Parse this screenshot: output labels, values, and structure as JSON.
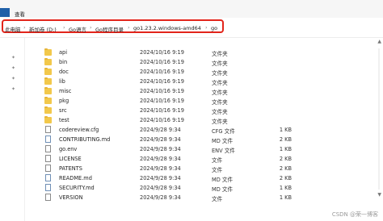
{
  "menubar": {
    "view_label": "查看"
  },
  "breadcrumb": {
    "items": [
      "此电脑",
      "新加卷 (D:)",
      "Go语言",
      "Go程序目录",
      "go1.23.2.windows-amd64",
      "go"
    ],
    "separator": "›"
  },
  "files": [
    {
      "name": "api",
      "date": "2024/10/16 9:19",
      "type": "文件夹",
      "size": "",
      "kind": "folder"
    },
    {
      "name": "bin",
      "date": "2024/10/16 9:19",
      "type": "文件夹",
      "size": "",
      "kind": "folder"
    },
    {
      "name": "doc",
      "date": "2024/10/16 9:19",
      "type": "文件夹",
      "size": "",
      "kind": "folder"
    },
    {
      "name": "lib",
      "date": "2024/10/16 9:19",
      "type": "文件夹",
      "size": "",
      "kind": "folder"
    },
    {
      "name": "misc",
      "date": "2024/10/16 9:19",
      "type": "文件夹",
      "size": "",
      "kind": "folder"
    },
    {
      "name": "pkg",
      "date": "2024/10/16 9:19",
      "type": "文件夹",
      "size": "",
      "kind": "folder"
    },
    {
      "name": "src",
      "date": "2024/10/16 9:19",
      "type": "文件夹",
      "size": "",
      "kind": "folder"
    },
    {
      "name": "test",
      "date": "2024/10/16 9:19",
      "type": "文件夹",
      "size": "",
      "kind": "folder"
    },
    {
      "name": "codereview.cfg",
      "date": "2024/9/28 9:34",
      "type": "CFG 文件",
      "size": "1 KB",
      "kind": "file"
    },
    {
      "name": "CONTRIBUTING.md",
      "date": "2024/9/28 9:34",
      "type": "MD 文件",
      "size": "2 KB",
      "kind": "md"
    },
    {
      "name": "go.env",
      "date": "2024/9/28 9:34",
      "type": "ENV 文件",
      "size": "1 KB",
      "kind": "file"
    },
    {
      "name": "LICENSE",
      "date": "2024/9/28 9:34",
      "type": "文件",
      "size": "2 KB",
      "kind": "file"
    },
    {
      "name": "PATENTS",
      "date": "2024/9/28 9:34",
      "type": "文件",
      "size": "2 KB",
      "kind": "file"
    },
    {
      "name": "README.md",
      "date": "2024/9/28 9:34",
      "type": "MD 文件",
      "size": "2 KB",
      "kind": "md"
    },
    {
      "name": "SECURITY.md",
      "date": "2024/9/28 9:34",
      "type": "MD 文件",
      "size": "1 KB",
      "kind": "md"
    },
    {
      "name": "VERSION",
      "date": "2024/9/28 9:34",
      "type": "文件",
      "size": "1 KB",
      "kind": "file"
    }
  ],
  "watermark": "CSDN @荣一博客",
  "colors": {
    "highlight_border": "#e2251b",
    "folder": "#f2c84b"
  }
}
